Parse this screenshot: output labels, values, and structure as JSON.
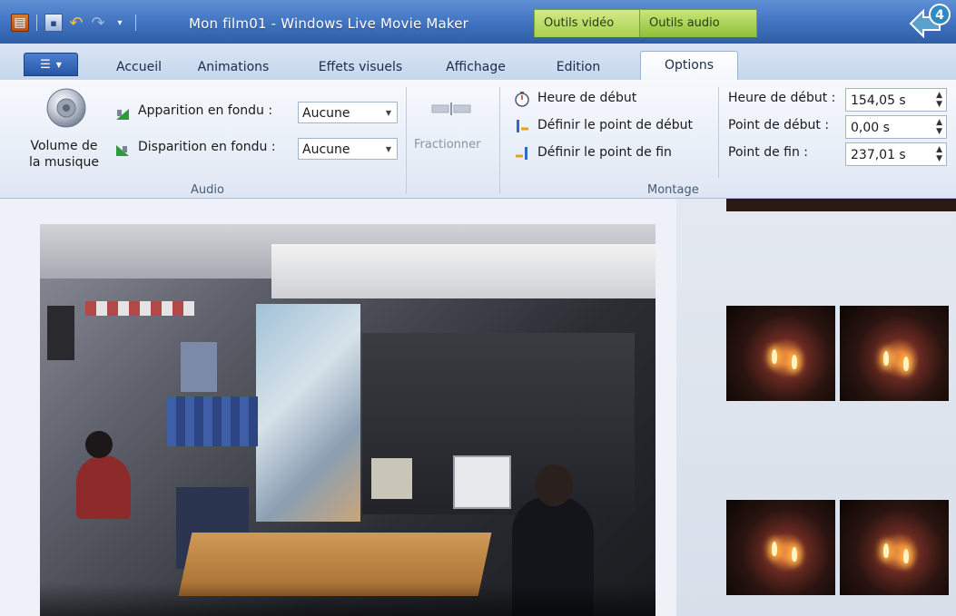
{
  "window": {
    "title": "Mon film01 - Windows Live Movie Maker",
    "badge_number": "4"
  },
  "context_tabs": {
    "video": "Outils vidéo",
    "audio": "Outils audio"
  },
  "tabs": [
    "Accueil",
    "Animations",
    "Effets visuels",
    "Affichage",
    "Edition",
    "Options"
  ],
  "ribbon": {
    "audio_group": {
      "label": "Audio",
      "music_volume": "Volume de la musique",
      "music_volume_line1": "Volume de",
      "music_volume_line2": "la musique",
      "fade_in_label": "Apparition en fondu :",
      "fade_in_value": "Aucune",
      "fade_out_label": "Disparition en fondu :",
      "fade_out_value": "Aucune"
    },
    "split": {
      "label": "Fractionner"
    },
    "montage_group": {
      "label": "Montage",
      "start_time_button": "Heure de début",
      "set_start_point": "Définir le point de début",
      "set_end_point": "Définir le point de fin",
      "start_time_label": "Heure de début :",
      "start_time_value": "154,05 s",
      "start_point_label": "Point de début :",
      "start_point_value": "0,00 s",
      "end_point_label": "Point de fin :",
      "end_point_value": "237,01 s"
    }
  },
  "colors": {
    "title_bar": "#3d6fbd",
    "context_tab": "#a8cf4e",
    "ribbon_bg": "#e6edf7"
  }
}
